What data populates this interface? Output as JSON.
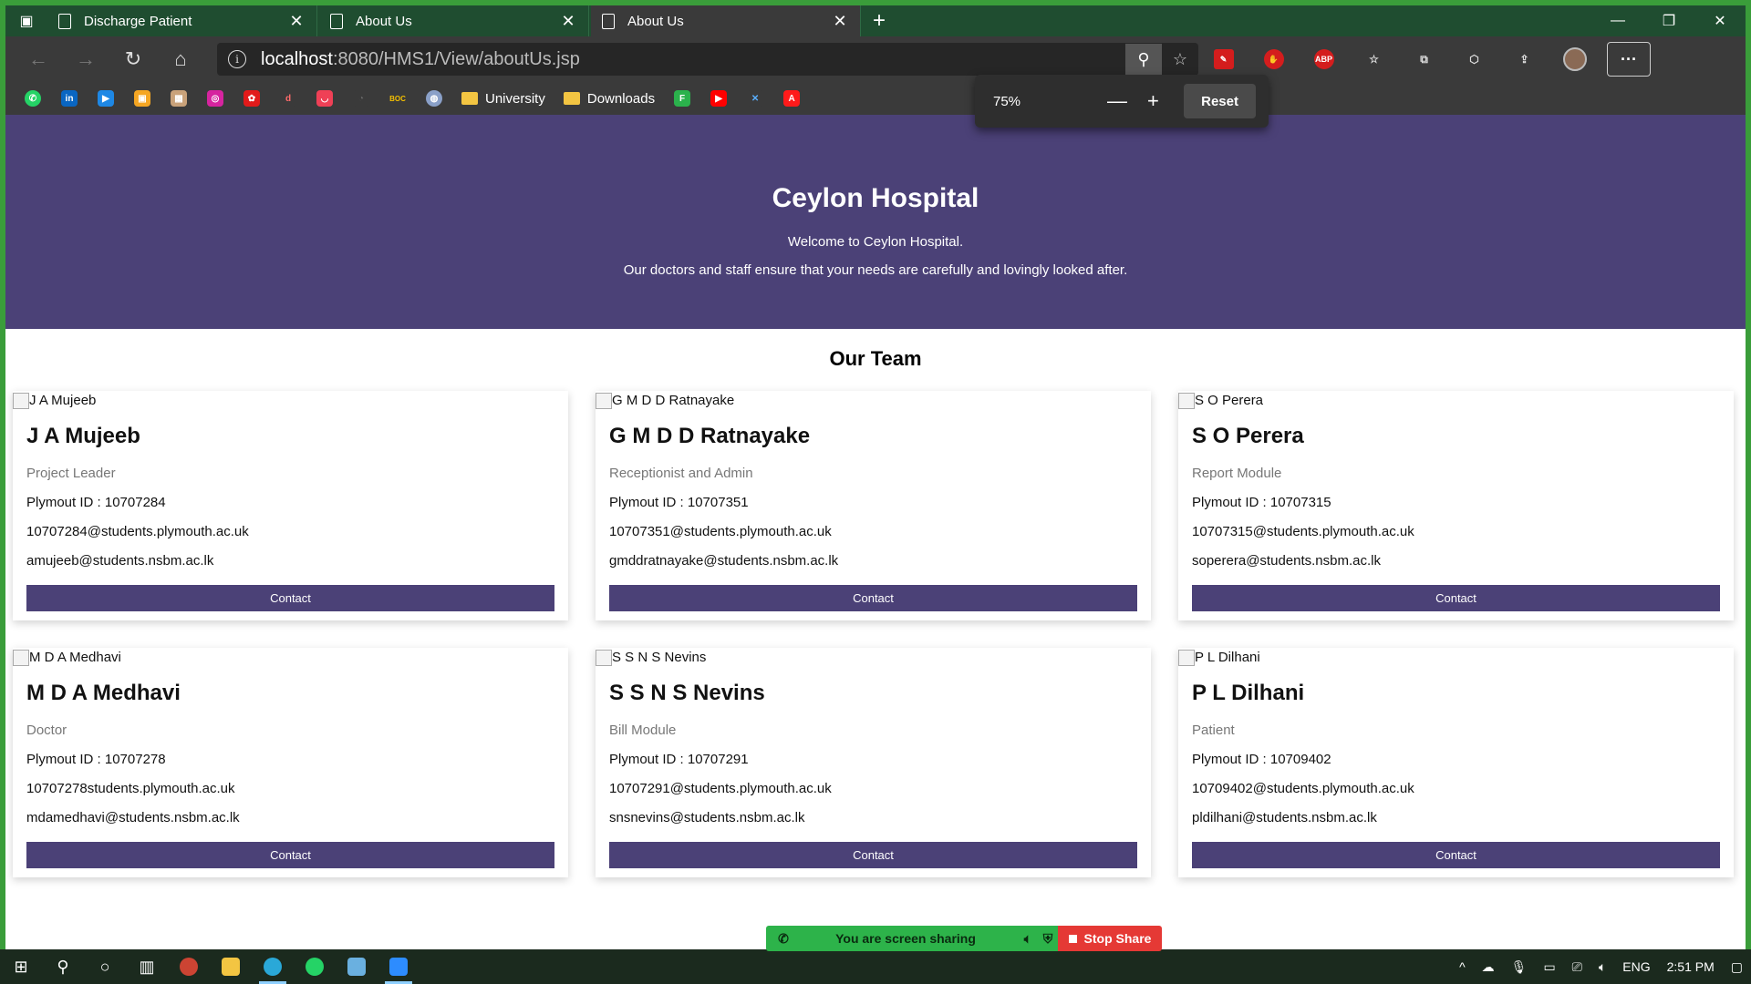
{
  "browser": {
    "tabs": [
      {
        "title": "Discharge Patient"
      },
      {
        "title": "About Us"
      },
      {
        "title": "About Us"
      }
    ],
    "url_host": "localhost",
    "url_path": ":8080/HMS1/View/aboutUs.jsp",
    "bookmarks": [
      {
        "label": "University"
      },
      {
        "label": "Downloads"
      }
    ],
    "zoom": {
      "level": "75%",
      "reset_label": "Reset"
    },
    "extensions": {
      "abp": "ABP"
    }
  },
  "hero": {
    "title": "Ceylon Hospital",
    "welcome": "Welcome to Ceylon Hospital.",
    "tagline": "Our doctors and staff ensure that your needs are carefully and lovingly looked after."
  },
  "team": {
    "title": "Our Team",
    "contact_label": "Contact",
    "members": [
      {
        "img_alt": "J A Mujeeb",
        "name": "J A Mujeeb",
        "role": "Project Leader",
        "plymouth_id": "Plymout ID : 10707284",
        "email1": "10707284@students.plymouth.ac.uk",
        "email2": "amujeeb@students.nsbm.ac.lk"
      },
      {
        "img_alt": "G M D D Ratnayake",
        "name": "G M D D Ratnayake",
        "role": "Receptionist and Admin",
        "plymouth_id": "Plymout ID : 10707351",
        "email1": "10707351@students.plymouth.ac.uk",
        "email2": "gmddratnayake@students.nsbm.ac.lk"
      },
      {
        "img_alt": "S O Perera",
        "name": "S O Perera",
        "role": "Report Module",
        "plymouth_id": "Plymout ID : 10707315",
        "email1": "10707315@students.plymouth.ac.uk",
        "email2": "soperera@students.nsbm.ac.lk"
      },
      {
        "img_alt": "M D A Medhavi",
        "name": "M D A Medhavi",
        "role": "Doctor",
        "plymouth_id": "Plymout ID : 10707278",
        "email1": "10707278students.plymouth.ac.uk",
        "email2": "mdamedhavi@students.nsbm.ac.lk"
      },
      {
        "img_alt": "S S N S Nevins",
        "name": "S S N S Nevins",
        "role": "Bill Module",
        "plymouth_id": "Plymout ID : 10707291",
        "email1": "10707291@students.plymouth.ac.uk",
        "email2": "snsnevins@students.nsbm.ac.lk"
      },
      {
        "img_alt": "P L Dilhani",
        "name": "P L Dilhani",
        "role": "Patient",
        "plymouth_id": "Plymout ID : 10709402",
        "email1": "10709402@students.plymouth.ac.uk",
        "email2": "pldilhani@students.nsbm.ac.lk"
      }
    ]
  },
  "screen_share": {
    "status": "You are screen sharing",
    "stop_label": "Stop Share"
  },
  "taskbar": {
    "language": "ENG",
    "time": "2:51 PM"
  },
  "colors": {
    "accent": "#4b4177",
    "window_frame": "#3a9d3a",
    "share_green": "#2db34a",
    "share_red": "#e53935"
  }
}
